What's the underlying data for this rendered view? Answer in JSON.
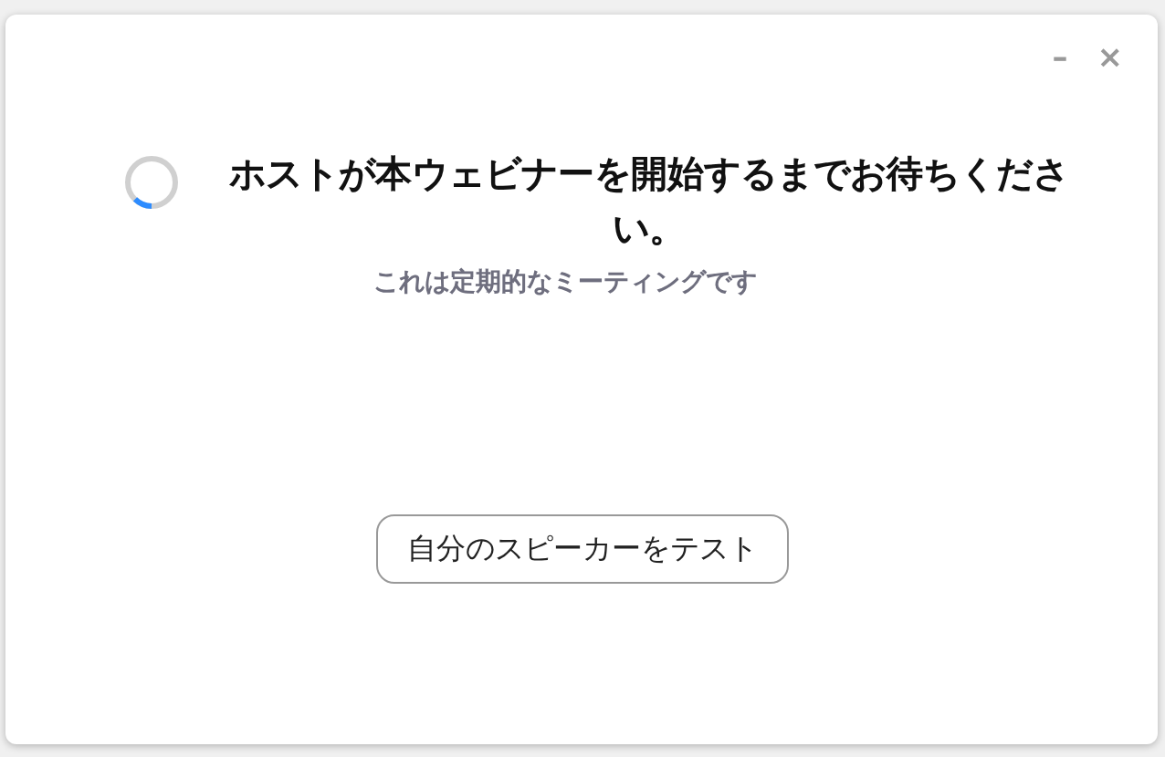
{
  "window": {
    "controls": [
      "–",
      "×"
    ]
  },
  "message": {
    "title": "ホストが本ウェビナーを開始するまでお待ちください。",
    "subtitle": "これは定期的なミーティングです"
  },
  "buttons": [
    "自分のスピーカーをテスト"
  ]
}
